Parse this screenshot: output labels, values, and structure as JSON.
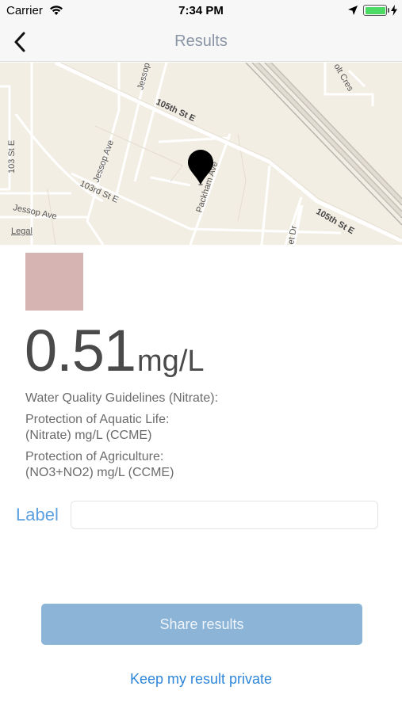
{
  "status_bar": {
    "carrier": "Carrier",
    "time": "7:34 PM",
    "icons": [
      "wifi-icon",
      "location-arrow-icon",
      "battery-icon",
      "charging-icon"
    ]
  },
  "nav": {
    "title": "Results",
    "back_icon": "chevron-left-icon"
  },
  "map": {
    "streets": {
      "s105_top": "105th St E",
      "s105_bottom": "105th St E",
      "s103": "103rd St E",
      "jessop_ave_diag": "Jessop Ave",
      "jessop_ave_left": "Jessop Ave",
      "jessop_top": "Jessop",
      "packham": "Packham Ave",
      "s103_left": "103 St E",
      "cres": "olt Cres",
      "dr": "et Dr"
    },
    "legal": "Legal",
    "pin_icon": "map-pin-icon"
  },
  "result": {
    "swatch_color": "#d5b4b1",
    "value": "0.51",
    "unit": "mg/L",
    "guidelines_title": "Water Quality Guidelines (Nitrate):",
    "aquatic_line1": "Protection of Aquatic Life:",
    "aquatic_line2": "(Nitrate) mg/L (CCME)",
    "agri_line1": "Protection of Agriculture:",
    "agri_line2": "(NO3+NO2) mg/L (CCME)"
  },
  "label_field": {
    "label": "Label",
    "value": "",
    "placeholder": ""
  },
  "actions": {
    "share": "Share results",
    "private": "Keep my result private"
  },
  "colors": {
    "accent": "#2f86d8",
    "button_bg": "#8cb4d6",
    "label_blue": "#5a9fe0"
  }
}
